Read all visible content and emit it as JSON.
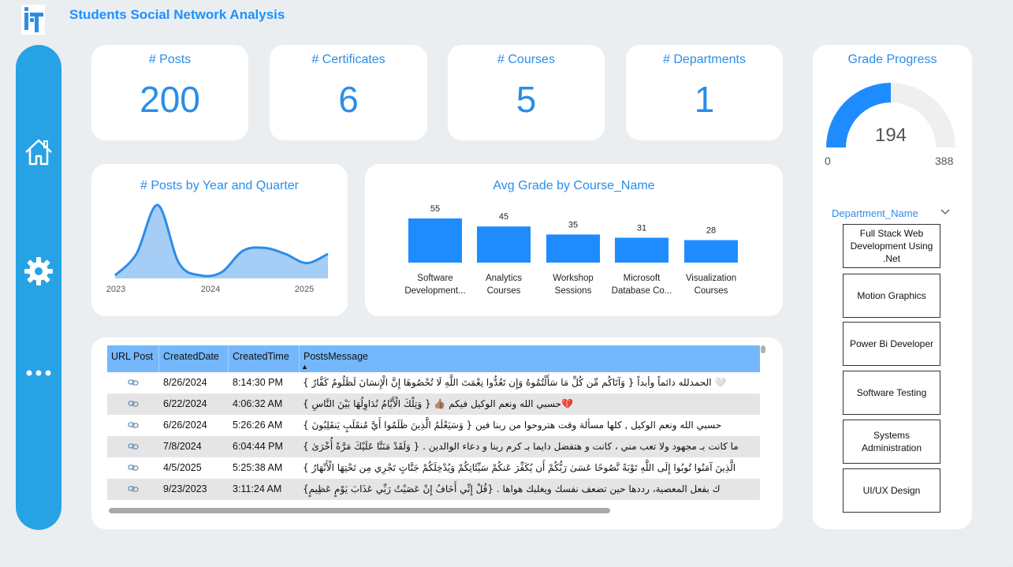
{
  "app": {
    "title": "Students Social Network Analysis"
  },
  "sidebar": {
    "items": [
      {
        "icon": "home-icon"
      },
      {
        "icon": "gear-icon"
      },
      {
        "icon": "more-icon"
      }
    ]
  },
  "kpis": [
    {
      "label": "# Posts",
      "value": "200"
    },
    {
      "label": "# Certificates",
      "value": "6"
    },
    {
      "label": "# Courses",
      "value": "5"
    },
    {
      "label": "# Departments",
      "value": "1"
    }
  ],
  "gauge": {
    "title": "Grade Progress",
    "value": 194,
    "min": 0,
    "max": 388,
    "value_label": "194",
    "min_label": "0",
    "max_label": "388",
    "fill_color": "#1e8cff",
    "track_color": "#efefef"
  },
  "posts_chart": {
    "title": "# Posts by Year and Quarter",
    "x_ticks": [
      "2023",
      "2024",
      "2025"
    ]
  },
  "grade_chart": {
    "title": "Avg Grade by Course_Name",
    "value_labels": [
      "55",
      "45",
      "35",
      "31",
      "28"
    ],
    "category_lines": [
      [
        "Software",
        "Development..."
      ],
      [
        "Analytics",
        "Courses"
      ],
      [
        "Workshop",
        "Sessions"
      ],
      [
        "Microsoft",
        "Database Co..."
      ],
      [
        "Visualization",
        "Courses"
      ]
    ]
  },
  "chart_data": [
    {
      "type": "area",
      "title": "# Posts by Year and Quarter",
      "x": [
        "2023 Q1",
        "2023 Q2",
        "2023 Q3",
        "2023 Q4",
        "2024 Q1",
        "2024 Q2",
        "2024 Q3",
        "2024 Q4",
        "2025 Q1",
        "2025 Q2",
        "2025 Q3"
      ],
      "y": [
        1,
        8,
        24,
        5,
        1,
        2,
        9,
        10,
        8,
        5,
        8
      ],
      "color": "#2b8de8",
      "fill_color": "#a5cdf5"
    },
    {
      "type": "bar",
      "title": "Avg Grade by Course_Name",
      "categories": [
        "Software Development...",
        "Analytics Courses",
        "Workshop Sessions",
        "Microsoft Database Co...",
        "Visualization Courses"
      ],
      "values": [
        55,
        45,
        35,
        31,
        28
      ],
      "color": "#1e8cff"
    }
  ],
  "table": {
    "columns": [
      "URL Post",
      "CreatedDate",
      "CreatedTime",
      "PostsMessage"
    ],
    "sort_indicator": "▲",
    "rows": [
      {
        "date": "8/26/2024",
        "time": "8:14:30 PM",
        "message": "🤍 الحمدلله دائماً وأبداً { وَآتَاكُم مِّن كُلِّ مَا سَأَلْتُمُوهُ وَإِن تَعُدُّوا نِعْمَتَ اللَّهِ لَا تُحْصُوهَا إِنَّ الْإِنسَانَ لَظَلُومٌ كَفَّارٌ }"
      },
      {
        "date": "6/22/2024",
        "time": "4:06:32 AM",
        "message": "💔حسبي الله ونعم الوكيل فيكم 👍🏽 { وَتِلْكَ الْأَيَّامُ نُدَاوِلُهَا بَيْنَ النَّاسِ }"
      },
      {
        "date": "6/26/2024",
        "time": "5:26:26 AM",
        "message": "حسبي الله ونعم الوكيل , كلها مسألة وقت هتروحوا من ربنا فين { وَسَيَعْلَمُ الَّذِينَ ظَلَمُوا أَيَّ مُنقَلَبٍ يَنقَلِبُونَ }"
      },
      {
        "date": "7/8/2024",
        "time": "6:04:44 PM",
        "message": "ما كانت بـ مجهود ولا تعب مني ، كانت و هتفضل دايما بـ كرم ربنا و دعاء الوالدين . { وَلَقَدْ مَنَنَّا عَلَيْكَ مَرَّةً أُخْرَىٰ }"
      },
      {
        "date": "4/5/2025",
        "time": "5:25:38 AM",
        "message": "الَّذِينَ آمَنُوا تُوبُوا إِلَى اللَّهِ تَوْبَةً نَّصُوحًا عَسَىٰ رَبُّكُمْ أَن يُكَفِّرَ عَنكُمْ سَيِّئَاتِكُمْ وَيُدْخِلَكُمْ جَنَّاتٍ تَجْرِي مِن تَحْتِهَا الْأَنْهَارُ }"
      },
      {
        "date": "9/23/2023",
        "time": "3:11:24 AM",
        "message": "ك بفعل المعصية، رددها حين تضعف نفسك ويغلبك هواها . {قُلْ إِنِّي أَخَافُ إِنْ عَصَيْتُ رَبِّي عَذَابَ يَوْمٍ عَظِيمٍ}"
      }
    ]
  },
  "slicer": {
    "title": "Department_Name",
    "items": [
      "Full Stack Web Development Using .Net",
      "Motion Graphics",
      "Power Bi Developer",
      "Software Testing",
      "Systems Administration",
      "UI/UX Design"
    ]
  }
}
